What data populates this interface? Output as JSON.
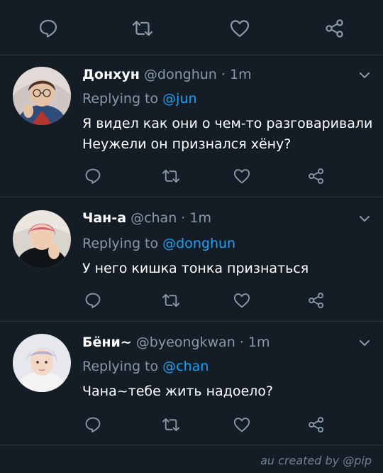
{
  "colors": {
    "background": "#141d26",
    "divider": "#2a3541",
    "muted": "#8899a6",
    "link": "#1da1f2",
    "text": "#ffffff"
  },
  "action_icons": [
    "reply-icon",
    "retweet-icon",
    "like-icon",
    "share-icon"
  ],
  "tweets": [
    {
      "author": "Донхун",
      "handle": "@donghun",
      "separator": "·",
      "time": "1m",
      "reply_prefix": "Replying to",
      "reply_to": "@jun",
      "text_lines": [
        "Я видел как они о чем-то разговаривали",
        "Неужели он признался хёну?"
      ]
    },
    {
      "author": "Чан-а",
      "handle": "@chan",
      "separator": "·",
      "time": "1m",
      "reply_prefix": "Replying to",
      "reply_to": "@donghun",
      "text_lines": [
        "У него кишка тонка признаться"
      ]
    },
    {
      "author": "Бёни~",
      "handle": "@byeongkwan",
      "separator": "·",
      "time": "1m",
      "reply_prefix": "Replying to",
      "reply_to": "@chan",
      "text_lines": [
        "Чана~тебе жить надоело?"
      ]
    }
  ],
  "watermark": "au created by @pip"
}
